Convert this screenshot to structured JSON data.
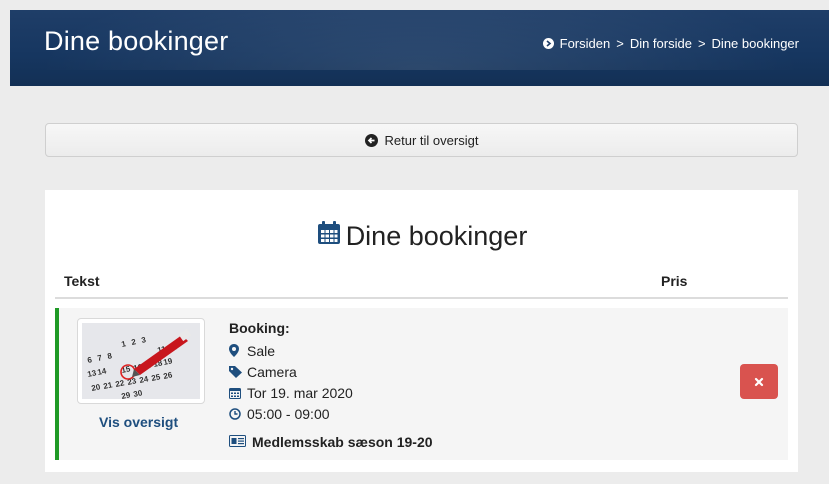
{
  "header": {
    "title": "Dine bookinger",
    "breadcrumb": {
      "home": "Forsiden",
      "sep1": ">",
      "page1": "Din forside",
      "sep2": ">",
      "current": "Dine bookinger"
    }
  },
  "back_button": {
    "label": "Retur til oversigt",
    "icon": "circle-arrow-left-icon"
  },
  "panel": {
    "heading": "Dine bookinger",
    "heading_icon": "calendar-icon",
    "columns": {
      "text": "Tekst",
      "price": "Pris"
    }
  },
  "booking": {
    "label": "Booking:",
    "location": "Sale",
    "item": "Camera",
    "date": "Tor 19. mar 2020",
    "time": "05:00 - 09:00",
    "membership": "Medlemsskab sæson 19-20",
    "link": "Vis oversigt",
    "thumb_numbers": [
      "1",
      "2",
      "3",
      "6",
      "7",
      "8",
      "11",
      "12",
      "13",
      "14",
      "15",
      "16",
      "17",
      "18",
      "19",
      "20",
      "21",
      "22",
      "23",
      "24",
      "25",
      "26",
      "29",
      "30"
    ],
    "icons": [
      "map-marker-icon",
      "tag-icon",
      "calendar-icon",
      "clock-icon",
      "id-card-icon"
    ],
    "accent": "#1f9a26"
  },
  "delete_button": {
    "label": "×",
    "color": "#d9534f"
  }
}
